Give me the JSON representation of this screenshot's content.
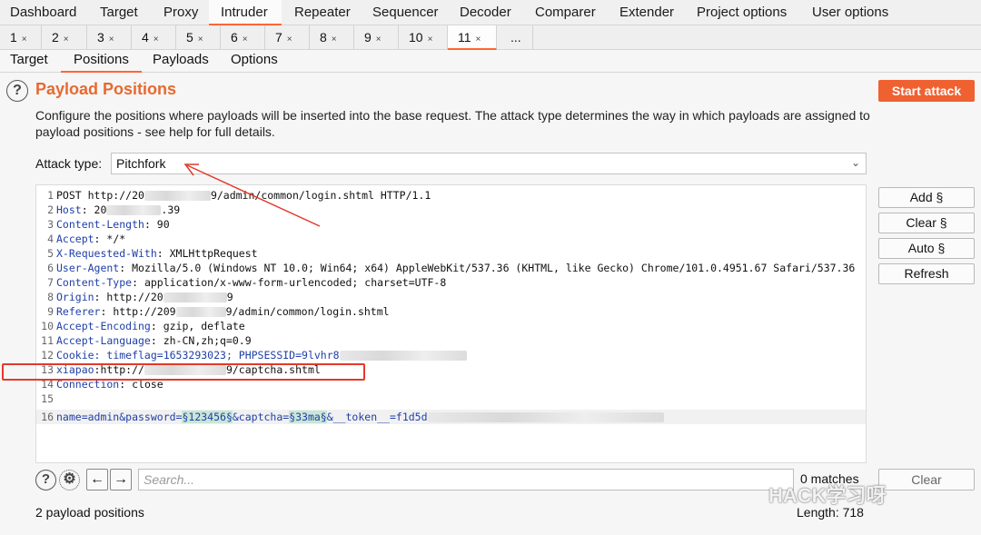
{
  "main_tabs": [
    "Dashboard",
    "Target",
    "Proxy",
    "Intruder",
    "Repeater",
    "Sequencer",
    "Decoder",
    "Comparer",
    "Extender",
    "Project options",
    "User options"
  ],
  "num_tabs": [
    "1",
    "2",
    "3",
    "4",
    "5",
    "6",
    "7",
    "8",
    "9",
    "10",
    "11",
    "..."
  ],
  "close_glyph": "×",
  "inner_tabs": [
    "Target",
    "Positions",
    "Payloads",
    "Options"
  ],
  "section": {
    "title": "Payload Positions",
    "start_attack": "Start attack",
    "description": "Configure the positions where payloads will be inserted into the base request. The attack type determines the way in which payloads are assigned to payload positions - see help for full details."
  },
  "attack": {
    "label": "Attack type:",
    "value": "Pitchfork"
  },
  "request": {
    "l1_num": "1",
    "l1_a": "POST http://20",
    "l1_b": "9/admin/common/login.shtml HTTP/1.1",
    "l2_num": "2",
    "l2_k": "Host",
    "l2_a": ": 20",
    "l2_b": ".39",
    "l3_num": "3",
    "l3_k": "Content-Length",
    "l3_v": ": 90",
    "l4_num": "4",
    "l4_k": "Accept",
    "l4_v": ": */*",
    "l5_num": "5",
    "l5_k": "X-Requested-With",
    "l5_v": ": XMLHttpRequest",
    "l6_num": "6",
    "l6_k": "User-Agent",
    "l6_v": ": Mozilla/5.0 (Windows NT 10.0; Win64; x64) AppleWebKit/537.36 (KHTML, like Gecko) Chrome/101.0.4951.67 Safari/537.36",
    "l7_num": "7",
    "l7_k": "Content-Type",
    "l7_v": ": application/x-www-form-urlencoded; charset=UTF-8",
    "l8_num": "8",
    "l8_k": "Origin",
    "l8_a": ": http://20",
    "l8_b": "9",
    "l9_num": "9",
    "l9_k": "Referer",
    "l9_a": ": http://209",
    "l9_b": "9/admin/common/login.shtml",
    "l10_num": "10",
    "l10_k": "Accept-Encoding",
    "l10_v": ": gzip, deflate",
    "l11_num": "11",
    "l11_k": "Accept-Language",
    "l11_v": ": zh-CN,zh;q=0.9",
    "l12_num": "12",
    "l12_k": "Cookie",
    "l12_v": ": timeflag=1653293023; PHPSESSID=9lvhr8",
    "l13_num": "13",
    "l13_k": "xiapao",
    "l13_a": ":http://",
    "l13_b": "9/captcha.shtml",
    "l14_num": "14",
    "l14_k": "Connection",
    "l14_v": ": close",
    "l15_num": "15",
    "l16_num": "16",
    "l16_a": "name=admin&password=",
    "l16_p1": "§123456§",
    "l16_b": "&captcha=",
    "l16_p2": "§33ma§",
    "l16_c": "&__token__=f1d5d"
  },
  "side_buttons": [
    "Add §",
    "Clear §",
    "Auto §",
    "Refresh"
  ],
  "search": {
    "placeholder": "Search...",
    "matches": "0 matches",
    "clear": "Clear"
  },
  "watermark": "HACK学习呀",
  "status": {
    "positions": "2 payload positions",
    "length": "Length: 718"
  },
  "colors": {
    "accent": "#ff6633",
    "title": "#e8692f",
    "button": "#ef6131",
    "annotation": "#e23a2b"
  }
}
